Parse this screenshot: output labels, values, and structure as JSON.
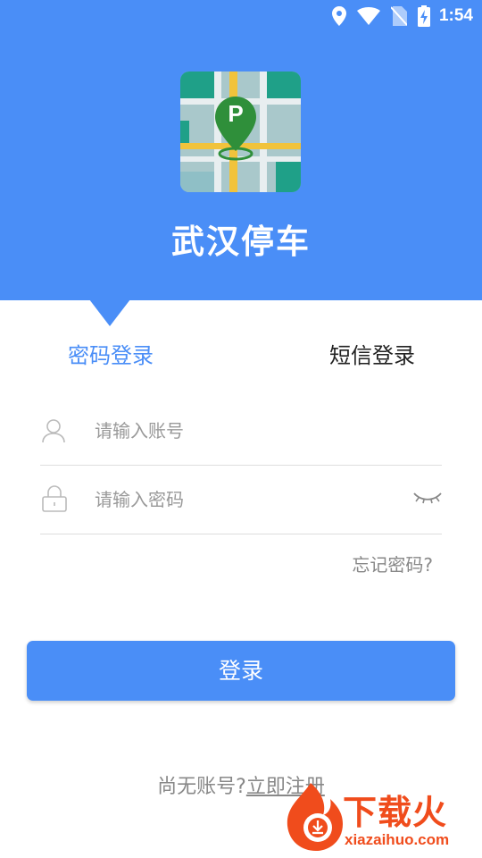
{
  "status_bar": {
    "time": "1:54"
  },
  "app": {
    "name": "武汉停车",
    "logo_letter": "P",
    "brand_color": "#4a8ef7"
  },
  "tabs": [
    {
      "label": "密码登录",
      "active": true
    },
    {
      "label": "短信登录",
      "active": false
    }
  ],
  "form": {
    "account_placeholder": "请输入账号",
    "password_placeholder": "请输入密码",
    "forgot_label": "忘记密码?"
  },
  "login_button_label": "登录",
  "register": {
    "prompt": "尚无账号?",
    "link": "立即注册"
  },
  "watermark": {
    "brand": "下载火",
    "domain": "xiazaihuo.com",
    "color": "#f04c1c"
  }
}
